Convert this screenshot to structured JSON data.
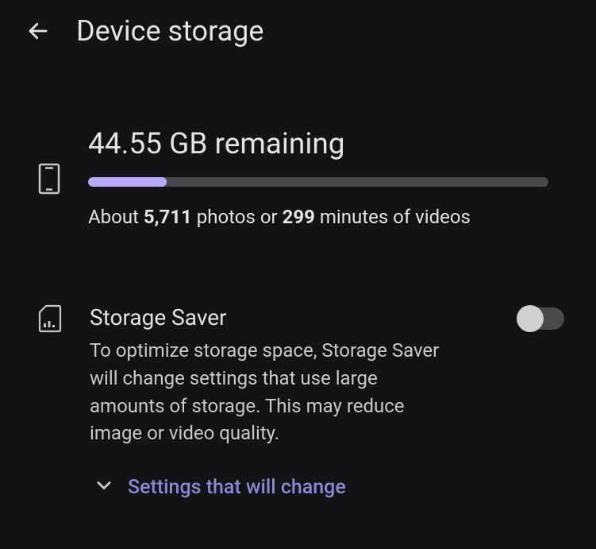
{
  "header": {
    "title": "Device storage"
  },
  "storage": {
    "remaining": "44.55 GB remaining",
    "progress_percent": 17,
    "estimate_prefix": "About ",
    "photos_count": "5,711",
    "estimate_mid": " photos or ",
    "minutes_count": "299",
    "estimate_suffix": " minutes of videos"
  },
  "saver": {
    "title": "Storage Saver",
    "description": "To optimize storage space, Storage Saver will change settings that use large amounts of storage. This may reduce image or video quality.",
    "toggle_on": false,
    "expand_label": "Settings that will change"
  }
}
